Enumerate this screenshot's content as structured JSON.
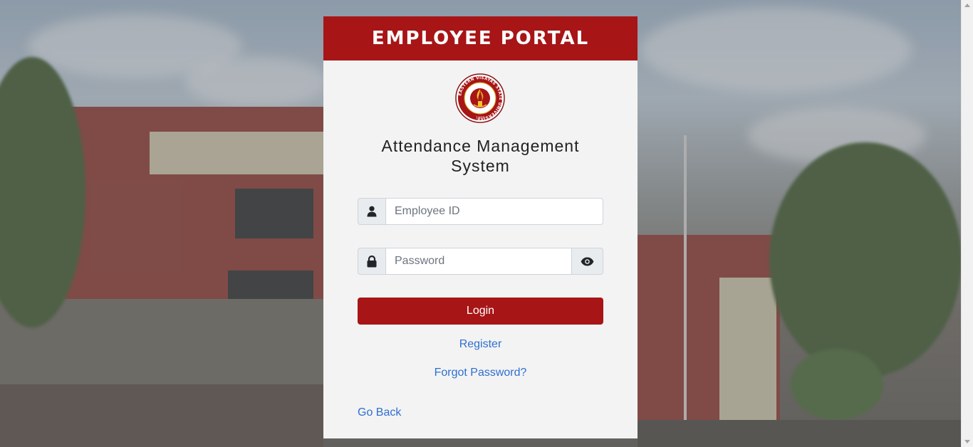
{
  "header": {
    "title": "EMPLOYEE PORTAL"
  },
  "seal": {
    "ring_text": "EASTERN VISAYAS STATE UNIVERSITY",
    "year": "1907"
  },
  "system_title": {
    "line1": "Attendance Management",
    "line2": "System"
  },
  "form": {
    "employee_id": {
      "placeholder": "Employee ID",
      "value": ""
    },
    "password": {
      "placeholder": "Password",
      "value": ""
    },
    "login_label": "Login"
  },
  "links": {
    "register": "Register",
    "forgot_password": "Forgot Password?",
    "go_back": "Go Back"
  },
  "colors": {
    "brand": "#a71516",
    "link": "#2e6fd1",
    "card_bg": "#f3f3f3"
  },
  "icons": {
    "user": "user-icon",
    "lock": "lock-icon",
    "eye": "eye-icon"
  }
}
